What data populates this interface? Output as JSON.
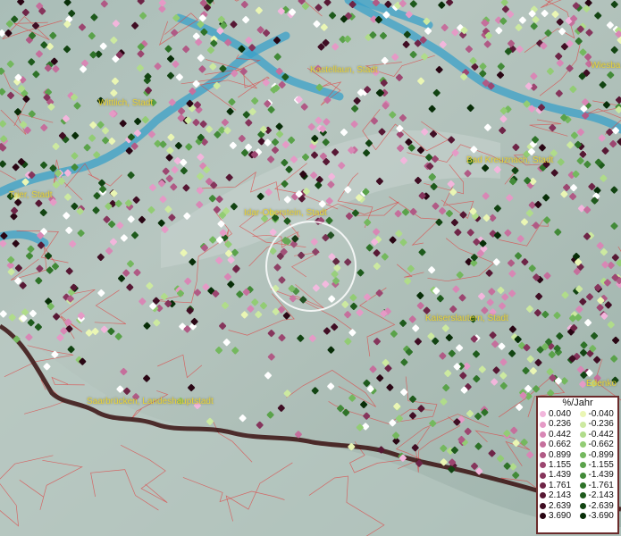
{
  "map": {
    "cities": [
      {
        "id": "wiesbaden",
        "label": "Wiesba"
      },
      {
        "id": "kastellaun",
        "label": "Kastellaun, Stadt"
      },
      {
        "id": "wittlich",
        "label": "Wittlich, Stadt"
      },
      {
        "id": "bad-kreuznach",
        "label": "Bad Kreuznach, Stadt"
      },
      {
        "id": "trier",
        "label": "Trier, Stadt"
      },
      {
        "id": "idar-oberstein",
        "label": "Idar-Oberstein, Stadt"
      },
      {
        "id": "kaiserslautern",
        "label": "Kaiserslautern, Stadt"
      },
      {
        "id": "edenkoben",
        "label": "Edenko"
      },
      {
        "id": "saarbruecken",
        "label": "Saarbrücken, Landeshauptstadt"
      }
    ],
    "colors": {
      "river": "#3aa0c8",
      "border": "#e04040",
      "country_border": "#3a1010",
      "selection_ring": "#ffffff"
    }
  },
  "legend": {
    "title": "%/Jahr",
    "positive": [
      {
        "label": "0.040",
        "color": "#f2b6dc"
      },
      {
        "label": "0.236",
        "color": "#e59ac6"
      },
      {
        "label": "0.442",
        "color": "#d887b5"
      },
      {
        "label": "0.662",
        "color": "#c56f9c"
      },
      {
        "label": "0.899",
        "color": "#b05a85"
      },
      {
        "label": "1.155",
        "color": "#9c4670"
      },
      {
        "label": "1.439",
        "color": "#86355c"
      },
      {
        "label": "1.761",
        "color": "#6e2547"
      },
      {
        "label": "2.143",
        "color": "#571834"
      },
      {
        "label": "2.639",
        "color": "#400e24"
      },
      {
        "label": "3.690",
        "color": "#2a0614"
      }
    ],
    "negative": [
      {
        "label": "-0.040",
        "color": "#eaf6b4"
      },
      {
        "label": "-0.236",
        "color": "#cce9a0"
      },
      {
        "label": "-0.442",
        "color": "#b0dc8a"
      },
      {
        "label": "-0.662",
        "color": "#92cc74"
      },
      {
        "label": "-0.899",
        "color": "#74b85e"
      },
      {
        "label": "-1.155",
        "color": "#5aa24a"
      },
      {
        "label": "-1.439",
        "color": "#428a38"
      },
      {
        "label": "-1.761",
        "color": "#2e7228"
      },
      {
        "label": "-2.143",
        "color": "#1e5a1c"
      },
      {
        "label": "-2.639",
        "color": "#124412"
      },
      {
        "label": "-3.690",
        "color": "#082e08"
      }
    ]
  }
}
